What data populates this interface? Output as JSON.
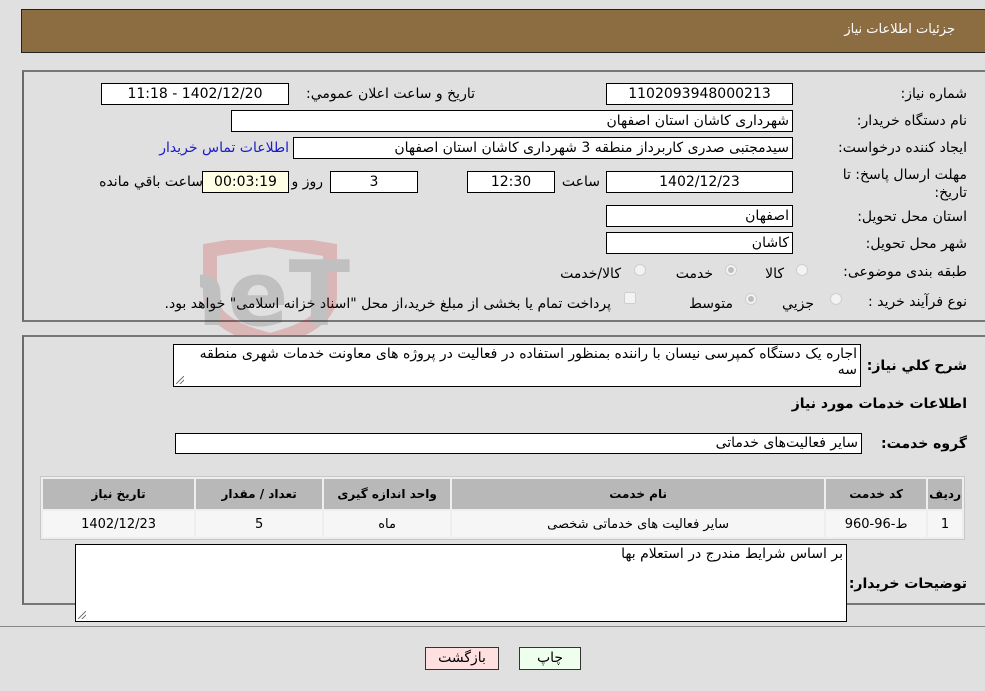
{
  "header": {
    "title": "جزئیات اطلاعات نیاز"
  },
  "details": {
    "need_number_label": "شماره نیاز:",
    "need_number": "1102093948000213",
    "announce_label": "تاریخ و ساعت اعلان عمومي:",
    "announce_value": "1402/12/20 - 11:18",
    "buyer_org_label": "نام دستگاه خریدار:",
    "buyer_org": "شهرداری کاشان استان اصفهان",
    "creator_label": "ایجاد کننده درخواست:",
    "creator": "سیدمجتبی صدری کاربرداز منطقه 3 شهرداری کاشان استان اصفهان",
    "contact_link": "اطلاعات تماس خریدار",
    "deadline_label": "مهلت ارسال پاسخ: تا تاریخ:",
    "deadline_date": "1402/12/23",
    "time_label": "ساعت",
    "deadline_time": "12:30",
    "days_value": "3",
    "days_label": "روز و",
    "remaining_value": "00:03:19",
    "remaining_label": "ساعت باقي مانده",
    "province_label": "استان محل تحویل:",
    "province": "اصفهان",
    "city_label": "شهر محل تحویل:",
    "city": "کاشان",
    "category_label": "طبقه بندی موضوعی:",
    "category_options": [
      {
        "label": "کالا",
        "selected": false
      },
      {
        "label": "خدمت",
        "selected": true
      },
      {
        "label": "کالا/خدمت",
        "selected": false
      }
    ],
    "process_label": "نوع فرآیند خرید :",
    "process_options": [
      {
        "label": "جزيي",
        "selected": false
      },
      {
        "label": "متوسط",
        "selected": true
      }
    ],
    "treasury_note": "پرداخت تمام یا بخشی از مبلغ خرید،از محل \"اسناد خزانه اسلامی\" خواهد بود.",
    "treasury_checked": false
  },
  "services": {
    "description_label": "شرح کلي نياز:",
    "description": "اجاره یک دستگاه کمپرسی نیسان با راننده بمنظور استفاده در فعالیت در پروژه های معاونت خدمات شهری منطقه سه",
    "section_title": "اطلاعات خدمات مورد نياز",
    "group_label": "گروه خدمت:",
    "group_value": "سایر فعالیت‌های خدماتی",
    "table": {
      "headers": [
        "ردیف",
        "کد خدمت",
        "نام خدمت",
        "واحد اندازه گیری",
        "تعداد / مقدار",
        "تاریخ نیاز"
      ],
      "rows": [
        [
          "1",
          "ط-96-960",
          "سایر فعالیت های خدماتی شخصی",
          "ماه",
          "5",
          "1402/12/23"
        ]
      ]
    },
    "buyer_notes_label": "توضیحات خریدار:",
    "buyer_notes": "بر اساس شرایط مندرج در استعلام بها"
  },
  "buttons": {
    "print": "چاپ",
    "back": "بازگشت"
  },
  "watermark": {
    "text": "AriaTender.neT"
  }
}
